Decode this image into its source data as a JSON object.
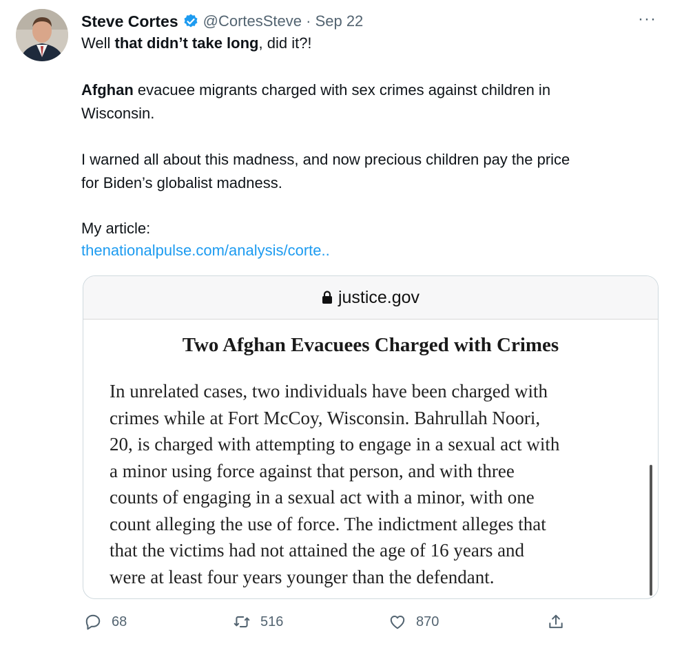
{
  "tweet": {
    "author_name": "Steve Cortes",
    "handle_date": "@CortesSteve · Sep 22",
    "more": "···",
    "line1_a": "Well ",
    "line1_b": "that didn’t take long",
    "line1_c": ", did it?!",
    "line2_a": "Afghan",
    "line2_b": " evacuee migrants charged with sex crimes against children in",
    "line3": "Wisconsin.",
    "line4": "I warned all about this madness, and now precious children pay the price",
    "line5": "for Biden’s globalist madness.",
    "line6": "My article:",
    "link": "thenationalpulse.com/analysis/corte..",
    "verified_icon": "verified-badge-icon"
  },
  "card": {
    "domain": "justice.gov",
    "title": "Two Afghan Evacuees Charged with Crimes",
    "lines": [
      "In unrelated cases, two individuals have been charged with",
      "crimes while at Fort McCoy, Wisconsin.  Bahrullah Noori,",
      "20, is charged with attempting to engage in a sexual act with",
      "a minor using force against that person, and with three",
      "counts of engaging in a sexual act with a minor, with one",
      "count alleging the use of force.  The indictment alleges that",
      "that the victims had not attained the age of 16 years and",
      "were at least four years younger than the defendant."
    ]
  },
  "actions": {
    "replies": "68",
    "retweets": "516",
    "likes": "870"
  },
  "colors": {
    "accent": "#1d9bf0",
    "muted": "#536471"
  }
}
